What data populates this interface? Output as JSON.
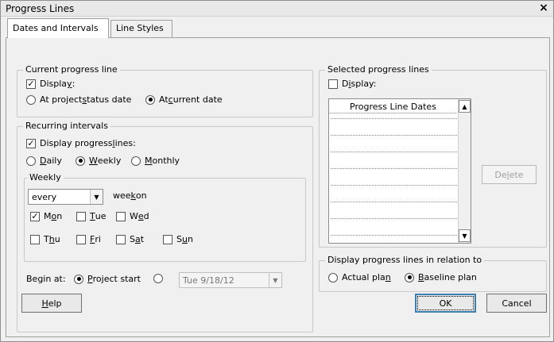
{
  "window": {
    "title": "Progress Lines",
    "close_glyph": "×"
  },
  "tabs": [
    {
      "label": "Dates and Intervals"
    },
    {
      "label": "Line Styles"
    }
  ],
  "current_progress_line": {
    "legend": "Current progress line",
    "display": {
      "label_pre": "Displa",
      "label_u": "y",
      "label_post": ":",
      "checked": true
    },
    "status_date": {
      "pre": "At project ",
      "u": "s",
      "post": "tatus date",
      "selected": false
    },
    "current_date": {
      "pre": "At ",
      "u": "c",
      "post": "urrent date",
      "selected": true
    }
  },
  "recurring_intervals": {
    "legend": "Recurring intervals",
    "display_lines": {
      "pre": "Display progress ",
      "u": "l",
      "post": "ines:",
      "checked": true
    },
    "daily": {
      "u": "D",
      "post": "aily",
      "selected": false
    },
    "weekly": {
      "u": "W",
      "post": "eekly",
      "selected": true
    },
    "monthly": {
      "u": "M",
      "post": "onthly",
      "selected": false
    },
    "weekly_group": {
      "legend": "Weekly",
      "every_value": "every",
      "week_on": {
        "pre": "wee",
        "u": "k",
        "post": " on"
      },
      "days": {
        "mon": {
          "pre": "M",
          "u": "o",
          "post": "n",
          "checked": true
        },
        "tue": {
          "pre": "",
          "u": "T",
          "post": "ue",
          "checked": false
        },
        "wed": {
          "pre": "W",
          "u": "e",
          "post": "d",
          "checked": false
        },
        "thu": {
          "pre": "T",
          "u": "h",
          "post": "u",
          "checked": false
        },
        "fri": {
          "pre": "",
          "u": "F",
          "post": "ri",
          "checked": false
        },
        "sat": {
          "pre": "S",
          "u": "a",
          "post": "t",
          "checked": false
        },
        "sun": {
          "pre": "S",
          "u": "u",
          "post": "n",
          "checked": false
        }
      }
    },
    "begin_at": {
      "label": "Begin at:",
      "project_start": {
        "u": "P",
        "post": "roject start",
        "selected": true
      },
      "date_value": "Tue 9/18/12"
    }
  },
  "selected_progress_lines": {
    "legend": "Selected progress lines",
    "display": {
      "pre": "D",
      "u": "i",
      "post": "splay:",
      "checked": false
    },
    "list_header": "Progress Line Dates",
    "delete": {
      "pre": "De",
      "u": "l",
      "post": "ete"
    }
  },
  "relation": {
    "legend": "Display progress lines in relation to",
    "actual": {
      "pre": "Actual pla",
      "u": "n",
      "post": "",
      "selected": false
    },
    "baseline": {
      "pre": "",
      "u": "B",
      "post": "aseline plan",
      "selected": true
    }
  },
  "buttons": {
    "help": {
      "u": "H",
      "post": "elp"
    },
    "ok": "OK",
    "cancel": "Cancel"
  }
}
